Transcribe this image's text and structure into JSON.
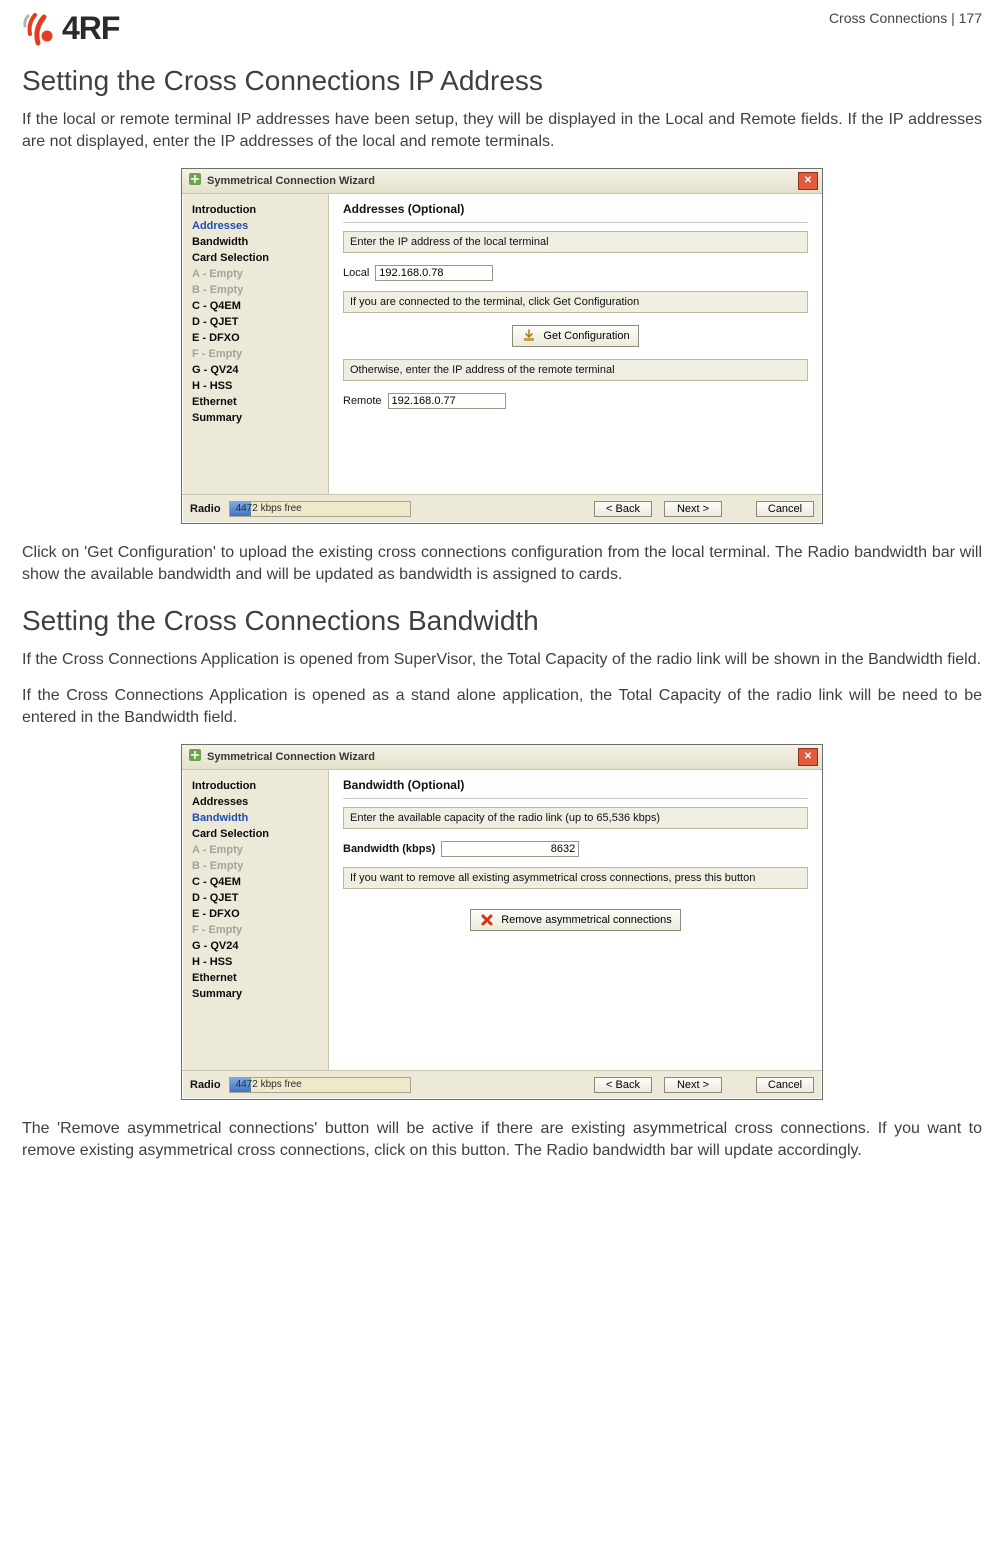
{
  "runningTitle": "Cross Connections  |  177",
  "logo": {
    "text": "4RF"
  },
  "section1": {
    "title": "Setting the Cross Connections IP Address",
    "p1": "If the local or remote terminal IP addresses have been setup, they will be displayed in the Local and Remote fields. If the IP addresses are not displayed, enter the IP addresses of the local and remote terminals.",
    "p2": "Click on 'Get Configuration' to upload the existing cross connections configuration from the local terminal. The Radio bandwidth bar will show the available bandwidth and will be updated as bandwidth is assigned to cards."
  },
  "section2": {
    "title": "Setting the Cross Connections Bandwidth",
    "p1": "If the Cross Connections Application is opened from SuperVisor, the Total Capacity of the radio link will be shown in the Bandwidth field.",
    "p2": "If the Cross Connections Application is opened as a stand alone application, the Total Capacity of the radio link will be need to be entered in the Bandwidth field.",
    "p3": "The 'Remove asymmetrical connections' button will be active if there are existing asymmetrical cross connections.  If you want to remove existing asymmetrical cross connections, click on this button. The Radio bandwidth bar will update accordingly."
  },
  "wizardCommon": {
    "title": "Symmetrical Connection Wizard",
    "radioLabel": "Radio",
    "bwFree": "4472 kbps free",
    "back": "< Back",
    "next": "Next >",
    "cancel": "Cancel"
  },
  "steps": {
    "s0": "Introduction",
    "s1": "Addresses",
    "s2": "Bandwidth",
    "s3": "Card Selection",
    "s4": "A - Empty",
    "s5": "B - Empty",
    "s6": "C - Q4EM",
    "s7": "D - QJET",
    "s8": "E - DFXO",
    "s9": "F - Empty",
    "s10": "G - QV24",
    "s11": "H - HSS",
    "s12": "Ethernet",
    "s13": "Summary"
  },
  "wiz1": {
    "heading": "Addresses (Optional)",
    "instr1": "Enter the IP address of the local terminal",
    "localLabel": "Local",
    "localValue": "192.168.0.78",
    "instr2": "If you are connected to the terminal, click Get Configuration",
    "getConfig": "Get Configuration",
    "instr3": "Otherwise, enter the IP address of the remote terminal",
    "remoteLabel": "Remote",
    "remoteValue": "192.168.0.77"
  },
  "wiz2": {
    "heading": "Bandwidth (Optional)",
    "instr1": "Enter the available capacity of the radio link (up to 65,536 kbps)",
    "bwLabel": "Bandwidth (kbps)",
    "bwValue": "8632",
    "instr2": "If you want to remove all existing asymmetrical cross connections, press this button",
    "removeBtn": "Remove asymmetrical connections"
  }
}
